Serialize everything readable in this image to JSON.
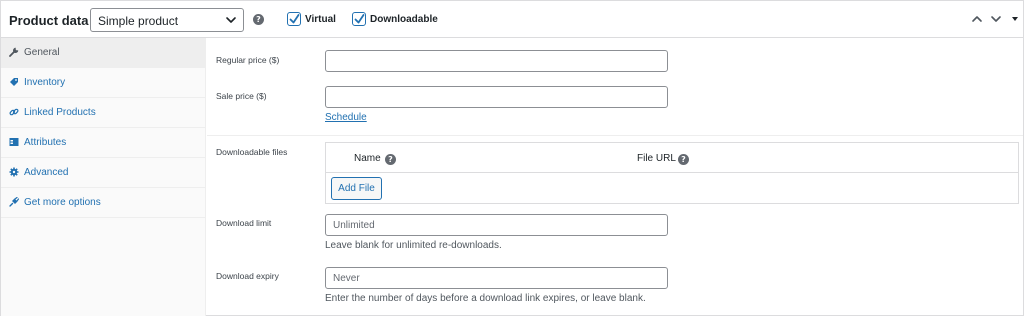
{
  "header": {
    "title": "Product data —",
    "product_type": "Simple product",
    "virtual_label": "Virtual",
    "virtual_checked": true,
    "downloadable_label": "Downloadable",
    "downloadable_checked": true
  },
  "icons": {
    "help": "?",
    "select_chevron": "chevron-down-icon",
    "move_up": "chevron-up-icon",
    "move_down": "chevron-down-icon",
    "toggle": "chevron-down-icon"
  },
  "sidebar": {
    "items": [
      {
        "label": "General",
        "icon": "wrench-icon",
        "active": true
      },
      {
        "label": "Inventory",
        "icon": "tag-icon",
        "active": false
      },
      {
        "label": "Linked Products",
        "icon": "link-icon",
        "active": false
      },
      {
        "label": "Attributes",
        "icon": "table-icon",
        "active": false
      },
      {
        "label": "Advanced",
        "icon": "gear-icon",
        "active": false
      },
      {
        "label": "Get more options",
        "icon": "plugin-icon",
        "active": false
      }
    ]
  },
  "general": {
    "regular_price_label": "Regular price ($)",
    "regular_price_value": "",
    "sale_price_label": "Sale price ($)",
    "sale_price_value": "",
    "schedule_link": "Schedule",
    "downloadable_files_label": "Downloadable files",
    "files_table": {
      "col_name": "Name",
      "col_url": "File URL",
      "add_button": "Add File"
    },
    "download_limit_label": "Download limit",
    "download_limit_placeholder": "Unlimited",
    "download_limit_help": "Leave blank for unlimited re-downloads.",
    "download_expiry_label": "Download expiry",
    "download_expiry_placeholder": "Never",
    "download_expiry_help": "Enter the number of days before a download link expires, or leave blank."
  },
  "colors": {
    "accent": "#2271b1",
    "text": "#1d2327",
    "border": "#dcdcde",
    "sidebar_bg": "#fafafa",
    "active_tab_bg": "#eeeeee"
  }
}
